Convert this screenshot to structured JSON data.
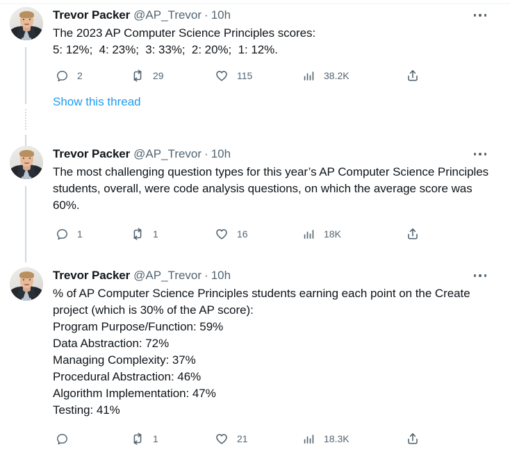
{
  "meta": {
    "platform": "Twitter",
    "view": "thread",
    "link_color": "#1d9bf0",
    "text_color": "#0f1419",
    "muted_color": "#536471",
    "thread_line_color": "#cfd9de"
  },
  "author": {
    "display_name": "Trevor Packer",
    "handle": "@AP_Trevor",
    "separator": "·",
    "avatar_alt": "Trevor Packer headshot"
  },
  "icons": {
    "reply": "reply-icon",
    "retweet": "retweet-icon",
    "like": "like-heart-icon",
    "views": "views-bar-chart-icon",
    "share": "share-icon",
    "more": "more-options-icon"
  },
  "tweets": [
    {
      "id": "tweet-1",
      "display_name": "Trevor Packer",
      "handle": "@AP_Trevor",
      "timestamp": "10h",
      "text": "The 2023 AP Computer Science Principles scores:\n5: 12%;  4: 23%;  3: 33%;  2: 20%;  1: 12%.",
      "show_thread_label": "Show this thread",
      "actions": {
        "reply_count": "2",
        "retweet_count": "29",
        "like_count": "115",
        "view_count": "38.2K"
      }
    },
    {
      "id": "tweet-2",
      "display_name": "Trevor Packer",
      "handle": "@AP_Trevor",
      "timestamp": "10h",
      "text": "The most challenging question types for this year’s AP Computer Science Principles students, overall, were code analysis questions, on which the average score was 60%.",
      "actions": {
        "reply_count": "1",
        "retweet_count": "1",
        "like_count": "16",
        "view_count": "18K"
      }
    },
    {
      "id": "tweet-3",
      "display_name": "Trevor Packer",
      "handle": "@AP_Trevor",
      "timestamp": "10h",
      "text": "% of AP Computer Science Principles students earning each point on the Create project (which is 30% of the AP score):\nProgram Purpose/Function: 59%\nData Abstraction: 72%\nManaging Complexity: 37%\nProcedural Abstraction: 46%\nAlgorithm Implementation: 47%\nTesting: 41%",
      "actions": {
        "reply_count": "",
        "retweet_count": "1",
        "like_count": "21",
        "view_count": "18.3K"
      }
    }
  ],
  "ap_score_distribution": {
    "exam": "AP Computer Science Principles",
    "year": "2023",
    "scores": [
      {
        "score": "5",
        "percent": "12%"
      },
      {
        "score": "4",
        "percent": "23%"
      },
      {
        "score": "3",
        "percent": "33%"
      },
      {
        "score": "2",
        "percent": "20%"
      },
      {
        "score": "1",
        "percent": "12%"
      }
    ]
  },
  "create_project_points": [
    {
      "label": "Program Purpose/Function",
      "percent": "59%"
    },
    {
      "label": "Data Abstraction",
      "percent": "72%"
    },
    {
      "label": "Managing Complexity",
      "percent": "37%"
    },
    {
      "label": "Procedural Abstraction",
      "percent": "46%"
    },
    {
      "label": "Algorithm Implementation",
      "percent": "47%"
    },
    {
      "label": "Testing",
      "percent": "41%"
    }
  ]
}
